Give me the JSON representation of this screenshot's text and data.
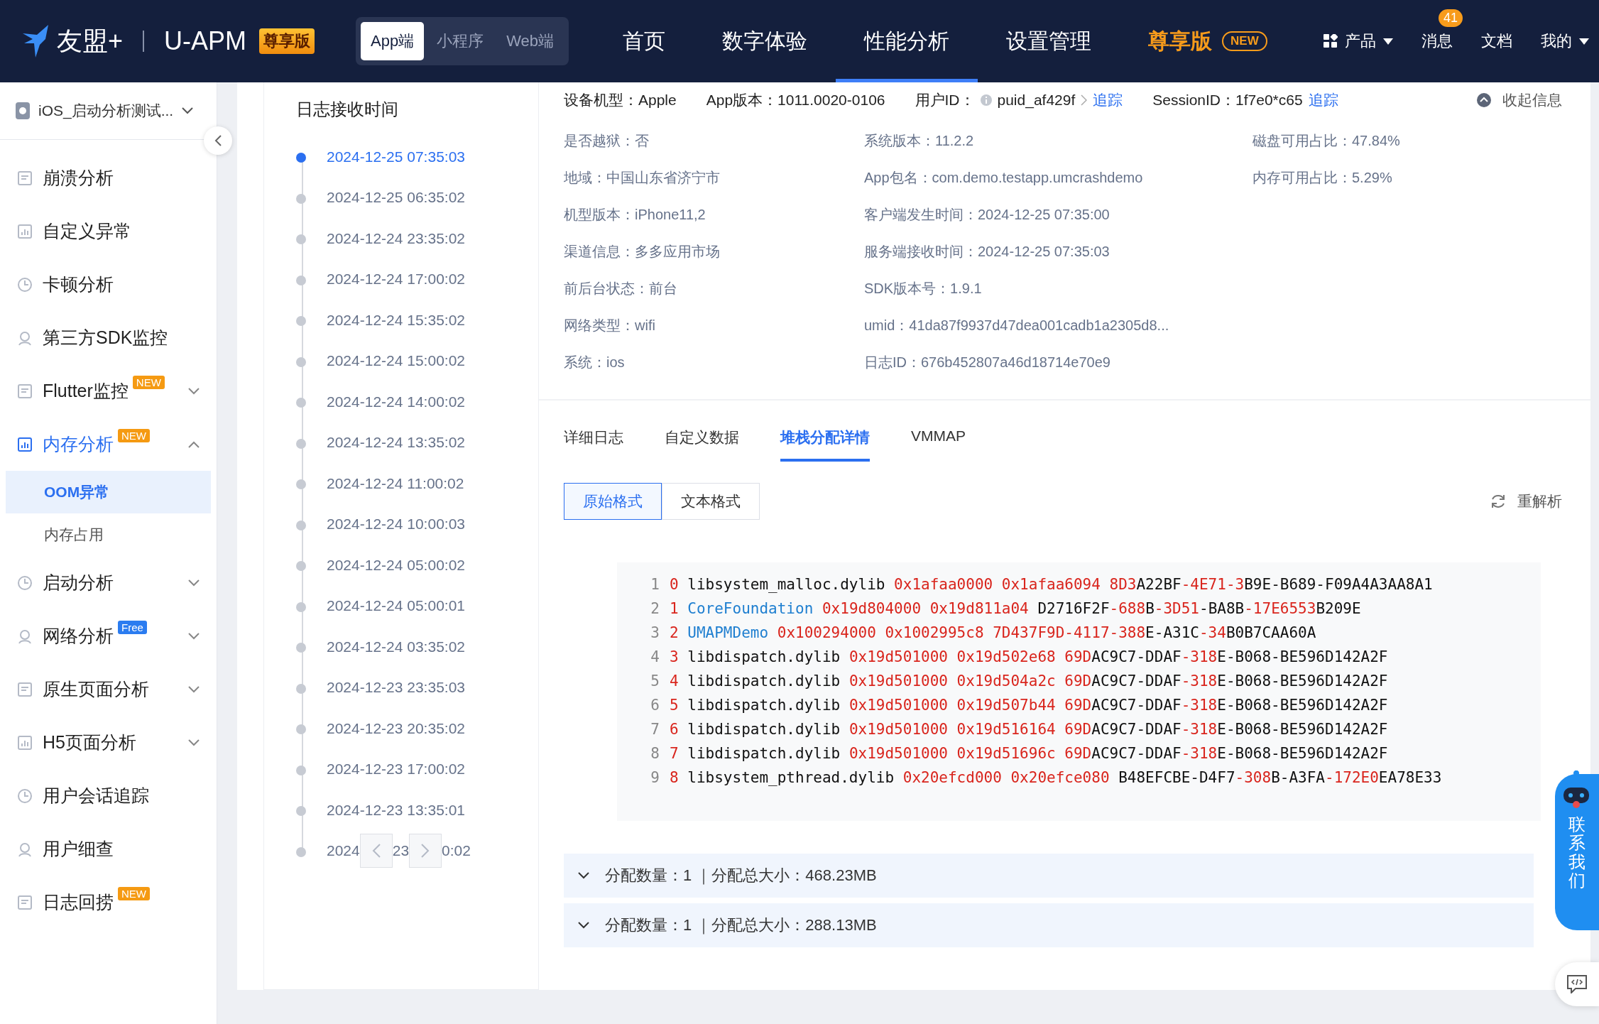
{
  "topbar": {
    "brand": "友盟+",
    "product": "U-APM",
    "edition_badge": "尊享版",
    "platform_tabs": [
      {
        "label": "App端",
        "selected": true
      },
      {
        "label": "小程序",
        "selected": false
      },
      {
        "label": "Web端",
        "selected": false
      }
    ],
    "nav": [
      {
        "label": "首页",
        "selected": false,
        "kind": "link"
      },
      {
        "label": "数字体验",
        "selected": false,
        "kind": "link"
      },
      {
        "label": "性能分析",
        "selected": true,
        "kind": "link"
      },
      {
        "label": "设置管理",
        "selected": false,
        "kind": "link"
      },
      {
        "label": "尊享版",
        "selected": false,
        "kind": "premium",
        "badge": "NEW"
      }
    ],
    "tools": [
      {
        "label": "产品",
        "kind": "menu"
      },
      {
        "label": "消息",
        "kind": "badge",
        "badge": "41"
      },
      {
        "label": "文档",
        "kind": "plain"
      },
      {
        "label": "我的",
        "kind": "menu"
      }
    ]
  },
  "sidebar": {
    "app_selector": "iOS_启动分析测试...",
    "items": [
      {
        "label": "崩溃分析",
        "selected": false
      },
      {
        "label": "自定义异常",
        "selected": false
      },
      {
        "label": "卡顿分析",
        "selected": false
      },
      {
        "label": "第三方SDK监控",
        "selected": false
      },
      {
        "label": "Flutter监控",
        "selected": false,
        "badge": {
          "text": "NEW",
          "color": "#f59a12"
        },
        "expanded": false
      },
      {
        "label": "内存分析",
        "selected": false,
        "badge": {
          "text": "NEW",
          "color": "#f59a12"
        },
        "expanded": true,
        "children": [
          {
            "label": "OOM异常",
            "selected": true
          },
          {
            "label": "内存占用",
            "selected": false
          }
        ]
      },
      {
        "label": "启动分析",
        "selected": false,
        "expanded": false
      },
      {
        "label": "网络分析",
        "selected": false,
        "badge": {
          "text": "Free",
          "color": "#2b7cf0"
        },
        "expanded": false
      },
      {
        "label": "原生页面分析",
        "selected": false,
        "expanded": false
      },
      {
        "label": "H5页面分析",
        "selected": false,
        "expanded": false
      },
      {
        "label": "用户会话追踪",
        "selected": false
      },
      {
        "label": "用户细查",
        "selected": false
      },
      {
        "label": "日志回捞",
        "selected": false,
        "badge": {
          "text": "NEW",
          "color": "#f59a12"
        }
      }
    ]
  },
  "timeline": {
    "title": "日志接收时间",
    "items": [
      {
        "time": "2024-12-25 07:35:03",
        "selected": true
      },
      {
        "time": "2024-12-25 06:35:02",
        "selected": false
      },
      {
        "time": "2024-12-24 23:35:02",
        "selected": false
      },
      {
        "time": "2024-12-24 17:00:02",
        "selected": false
      },
      {
        "time": "2024-12-24 15:35:02",
        "selected": false
      },
      {
        "time": "2024-12-24 15:00:02",
        "selected": false
      },
      {
        "time": "2024-12-24 14:00:02",
        "selected": false
      },
      {
        "time": "2024-12-24 13:35:02",
        "selected": false
      },
      {
        "time": "2024-12-24 11:00:02",
        "selected": false
      },
      {
        "time": "2024-12-24 10:00:03",
        "selected": false
      },
      {
        "time": "2024-12-24 05:00:02",
        "selected": false
      },
      {
        "time": "2024-12-24 05:00:01",
        "selected": false
      },
      {
        "time": "2024-12-24 03:35:02",
        "selected": false
      },
      {
        "time": "2024-12-23 23:35:03",
        "selected": false
      },
      {
        "time": "2024-12-23 20:35:02",
        "selected": false
      },
      {
        "time": "2024-12-23 17:00:02",
        "selected": false
      },
      {
        "time": "2024-12-23 13:35:01",
        "selected": false
      }
    ],
    "covered_item": {
      "parts": [
        "2024",
        "23",
        "0:02"
      ]
    }
  },
  "detail": {
    "header": [
      {
        "text": "设备机型：Apple"
      },
      {
        "text": "App版本：1011.0020-0106"
      },
      {
        "text": "用户ID：",
        "value": "puid_af429f",
        "link": "追踪",
        "kind": "user"
      },
      {
        "text": "SessionID：1f7e0*c65",
        "link": "追踪",
        "kind": "session"
      }
    ],
    "collapse": "收起信息",
    "columns": [
      [
        "是否越狱：否",
        "地域：中国山东省济宁市",
        "机型版本：iPhone11,2",
        "渠道信息：多多应用市场",
        "前后台状态：前台",
        "网络类型：wifi",
        "系统：ios"
      ],
      [
        "系统版本：11.2.2",
        "App包名：com.demo.testapp.umcrashdemo",
        "客户端发生时间：2024-12-25 07:35:00",
        "服务端接收时间：2024-12-25 07:35:03",
        "SDK版本号：1.9.1",
        "umid：41da87f9937d47dea001cadb1a2305d8...",
        "日志ID：676b452807a46d18714e70e9"
      ],
      [
        "磁盘可用占比：47.84%",
        "内存可用占比：5.29%"
      ]
    ],
    "tabs": [
      {
        "label": "详细日志",
        "selected": false
      },
      {
        "label": "自定义数据",
        "selected": false
      },
      {
        "label": "堆栈分配详情",
        "selected": true
      },
      {
        "label": "VMMAP",
        "selected": false
      }
    ],
    "formats": [
      {
        "label": "原始格式",
        "selected": true
      },
      {
        "label": "文本格式",
        "selected": false
      }
    ],
    "reparse": "重解析",
    "stack_lines": [
      {
        "number": "1",
        "segments": [
          {
            "text": "0",
            "kind": "hl"
          },
          {
            "text": " libsystem_malloc.dylib ",
            "kind": "plain"
          },
          {
            "text": "0x1afaa0000 0x1afaa6094 8D3",
            "kind": "hl"
          },
          {
            "text": "A22BF",
            "kind": "plain"
          },
          {
            "text": "-4E71-3",
            "kind": "hl"
          },
          {
            "text": "B9E-B689-F09A4A3AA8A1",
            "kind": "plain"
          }
        ]
      },
      {
        "number": "2",
        "segments": [
          {
            "text": "1",
            "kind": "hl"
          },
          {
            "text": " CoreFoundation",
            "kind": "module"
          },
          {
            "text": " 0x19d804000 0x19d811a04",
            "kind": "hl"
          },
          {
            "text": " D2716F2F",
            "kind": "plain"
          },
          {
            "text": "-688",
            "kind": "hl"
          },
          {
            "text": "B",
            "kind": "plain"
          },
          {
            "text": "-3D51",
            "kind": "hl"
          },
          {
            "text": "-BA8B",
            "kind": "plain"
          },
          {
            "text": "-17E6553",
            "kind": "hl"
          },
          {
            "text": "B209E",
            "kind": "plain"
          }
        ]
      },
      {
        "number": "3",
        "segments": [
          {
            "text": "2",
            "kind": "hl"
          },
          {
            "text": " UMAPMDemo",
            "kind": "module"
          },
          {
            "text": " 0x100294000 0x1002995c8 7D437F9D-4117-388",
            "kind": "hl"
          },
          {
            "text": "E-A31C",
            "kind": "plain"
          },
          {
            "text": "-34",
            "kind": "hl"
          },
          {
            "text": "B0B7CAA60A",
            "kind": "plain"
          }
        ]
      },
      {
        "number": "4",
        "segments": [
          {
            "text": "3",
            "kind": "hl"
          },
          {
            "text": " libdispatch.dylib ",
            "kind": "plain"
          },
          {
            "text": "0x19d501000 0x19d502e68 69D",
            "kind": "hl"
          },
          {
            "text": "AC9C7-DDAF",
            "kind": "plain"
          },
          {
            "text": "-318",
            "kind": "hl"
          },
          {
            "text": "E-B068-BE596D142A2F",
            "kind": "plain"
          }
        ]
      },
      {
        "number": "5",
        "segments": [
          {
            "text": "4",
            "kind": "hl"
          },
          {
            "text": " libdispatch.dylib ",
            "kind": "plain"
          },
          {
            "text": "0x19d501000 0x19d504a2c 69D",
            "kind": "hl"
          },
          {
            "text": "AC9C7-DDAF",
            "kind": "plain"
          },
          {
            "text": "-318",
            "kind": "hl"
          },
          {
            "text": "E-B068-BE596D142A2F",
            "kind": "plain"
          }
        ]
      },
      {
        "number": "6",
        "segments": [
          {
            "text": "5",
            "kind": "hl"
          },
          {
            "text": " libdispatch.dylib ",
            "kind": "plain"
          },
          {
            "text": "0x19d501000 0x19d507b44 69D",
            "kind": "hl"
          },
          {
            "text": "AC9C7-DDAF",
            "kind": "plain"
          },
          {
            "text": "-318",
            "kind": "hl"
          },
          {
            "text": "E-B068-BE596D142A2F",
            "kind": "plain"
          }
        ]
      },
      {
        "number": "7",
        "segments": [
          {
            "text": "6",
            "kind": "hl"
          },
          {
            "text": " libdispatch.dylib ",
            "kind": "plain"
          },
          {
            "text": "0x19d501000 0x19d516164 69D",
            "kind": "hl"
          },
          {
            "text": "AC9C7-DDAF",
            "kind": "plain"
          },
          {
            "text": "-318",
            "kind": "hl"
          },
          {
            "text": "E-B068-BE596D142A2F",
            "kind": "plain"
          }
        ]
      },
      {
        "number": "8",
        "segments": [
          {
            "text": "7",
            "kind": "hl"
          },
          {
            "text": " libdispatch.dylib ",
            "kind": "plain"
          },
          {
            "text": "0x19d501000 0x19d51696c 69D",
            "kind": "hl"
          },
          {
            "text": "AC9C7-DDAF",
            "kind": "plain"
          },
          {
            "text": "-318",
            "kind": "hl"
          },
          {
            "text": "E-B068-BE596D142A2F",
            "kind": "plain"
          }
        ]
      },
      {
        "number": "9",
        "segments": [
          {
            "text": "8",
            "kind": "hl"
          },
          {
            "text": " libsystem_pthread.dylib ",
            "kind": "plain"
          },
          {
            "text": "0x20efcd000 0x20efce080",
            "kind": "hl"
          },
          {
            "text": " B48EFCBE-D4F7",
            "kind": "plain"
          },
          {
            "text": "-308",
            "kind": "hl"
          },
          {
            "text": "B-A3FA",
            "kind": "plain"
          },
          {
            "text": "-172E0",
            "kind": "hl"
          },
          {
            "text": "EA78E33",
            "kind": "plain"
          }
        ]
      }
    ],
    "allocations": [
      {
        "text": "分配数量：1 ｜分配总大小：468.23MB",
        "expanded": false
      },
      {
        "text": "分配数量：1 ｜分配总大小：288.13MB",
        "expanded": false
      }
    ]
  },
  "contact": {
    "label": "联系我们"
  }
}
